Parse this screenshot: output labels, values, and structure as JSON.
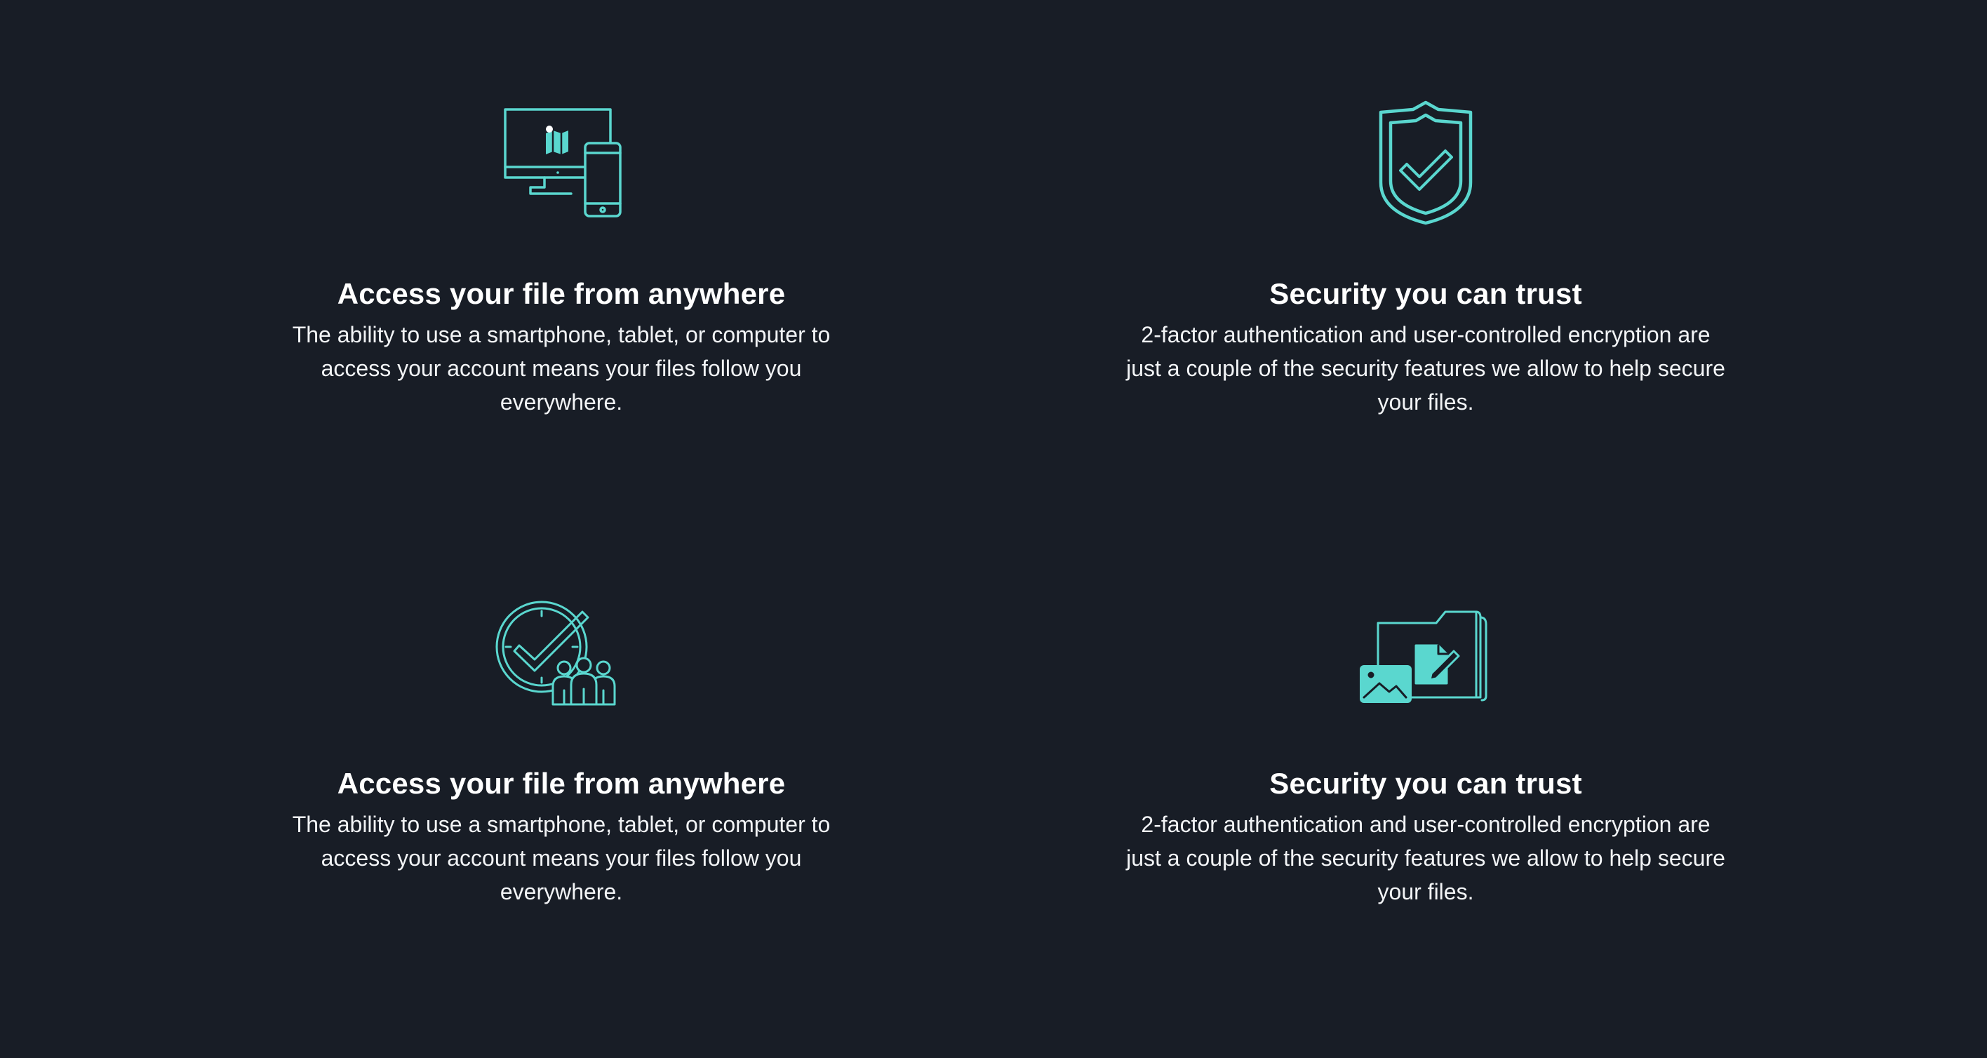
{
  "accent_color": "#5ad7cf",
  "background_color": "#181d26",
  "features": [
    {
      "icon": "devices-icon",
      "title": "Access your file from anywhere",
      "description": "The ability to use a smartphone, tablet, or computer to access your account means your files follow you everywhere."
    },
    {
      "icon": "shield-check-icon",
      "title": "Security you can trust",
      "description": "2-factor authentication and user-controlled encryption are just a couple of the security features we allow to help secure your files."
    },
    {
      "icon": "team-clock-check-icon",
      "title": "Access your file from anywhere",
      "description": "The ability to use a smartphone, tablet, or computer to access your account means your files follow you everywhere."
    },
    {
      "icon": "folder-files-icon",
      "title": "Security you can trust",
      "description": "2-factor authentication and user-controlled encryption are just a couple of the security features we allow to help secure your files."
    }
  ]
}
